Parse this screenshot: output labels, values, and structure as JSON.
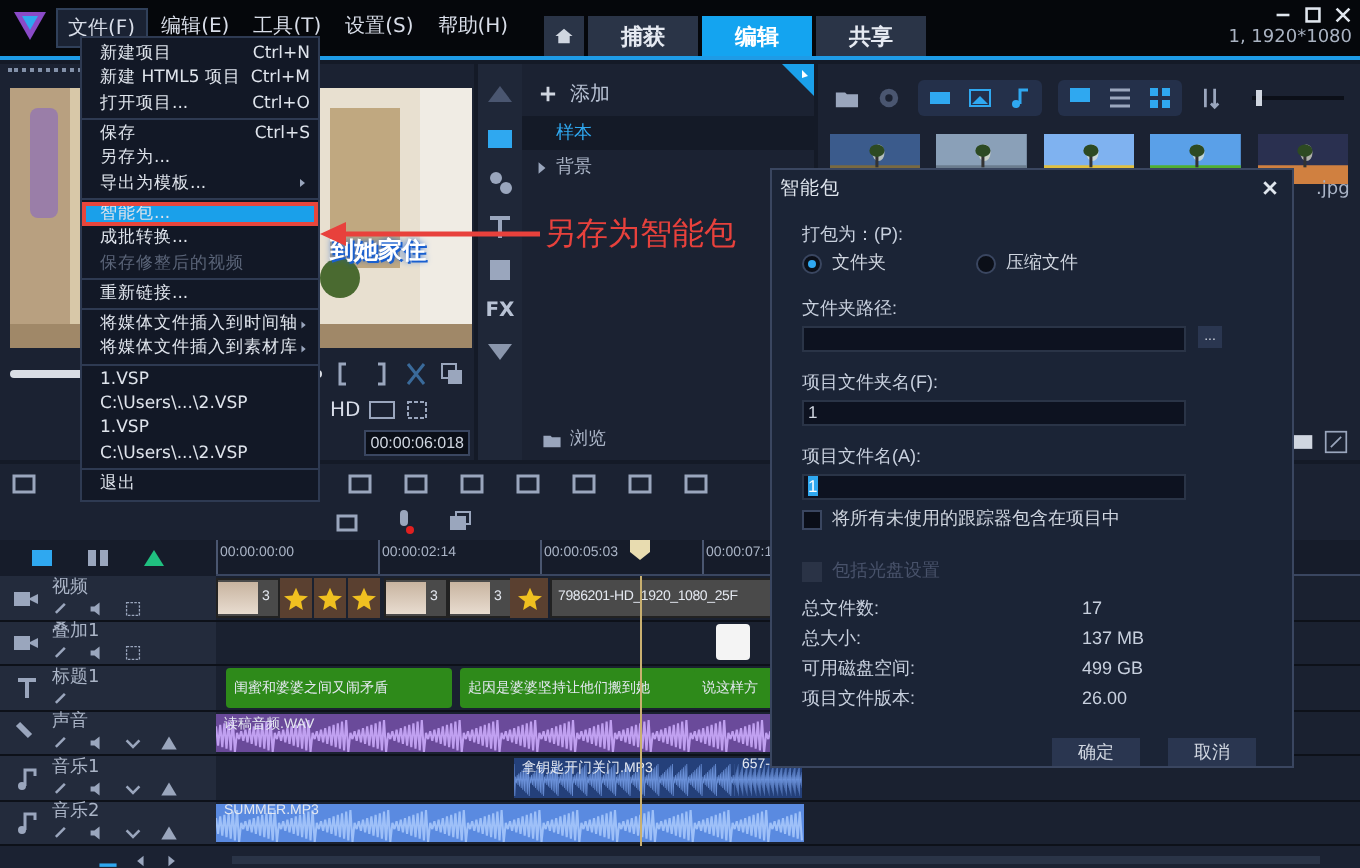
{
  "menubar": {
    "items": [
      {
        "label": "文件(F)",
        "selected": true
      },
      {
        "label": "编辑(E)",
        "selected": false
      },
      {
        "label": "工具(T)",
        "selected": false
      },
      {
        "label": "设置(S)",
        "selected": false
      },
      {
        "label": "帮助(H)",
        "selected": false
      }
    ]
  },
  "tabs": [
    {
      "label": "捕获",
      "selected": false
    },
    {
      "label": "编辑",
      "selected": true
    },
    {
      "label": "共享",
      "selected": false
    }
  ],
  "resolution": "1, 1920*1080",
  "player": {
    "subtitle": "到她家住",
    "format": "HD",
    "timecode": "00:00:06:018"
  },
  "library": {
    "add_label": "添加",
    "nav_fx": "FX",
    "tree": [
      {
        "label": "样本",
        "selected": true,
        "expandable": false
      },
      {
        "label": "背景",
        "selected": false,
        "expandable": true
      }
    ],
    "browse_label": "浏览",
    "zoom_slider": {
      "level": 0.05
    },
    "file_label": ".jpg"
  },
  "timeline": {
    "ruler": [
      "00:00:00:00",
      "00:00:02:14",
      "00:00:05:03",
      "00:00:07:1"
    ],
    "tracks": [
      {
        "kind": "video",
        "name": "视频"
      },
      {
        "kind": "overlay",
        "name": "叠加1"
      },
      {
        "kind": "title",
        "name": "标题1"
      },
      {
        "kind": "voice",
        "name": "声音"
      },
      {
        "kind": "music",
        "name": "音乐1"
      },
      {
        "kind": "music",
        "name": "音乐2"
      }
    ],
    "video_clips": [
      {
        "label": "3"
      },
      {
        "kind": "transition"
      },
      {
        "kind": "transition"
      },
      {
        "kind": "transition"
      },
      {
        "label": "3"
      },
      {
        "label": "3"
      },
      {
        "kind": "transition"
      },
      {
        "kind": "video",
        "label": "7986201-HD_1920_1080_25F"
      }
    ],
    "title_clips": [
      {
        "label": "闺蜜和婆婆之间又闹矛盾"
      },
      {
        "label": "起因是婆婆坚持让他们搬到她"
      },
      {
        "label": "说这样方"
      }
    ],
    "voice_clips": [
      {
        "label": "读稿音频.WAV"
      }
    ],
    "music1_clips": [
      {
        "label": "拿钥匙开门关门.MP3"
      },
      {
        "label": "657-"
      }
    ],
    "music2_clips": [
      {
        "label": "SUMMER.MP3"
      }
    ]
  },
  "file_menu": {
    "groups": [
      {
        "items": [
          {
            "label": "新建项目",
            "shortcut": "Ctrl+N"
          },
          {
            "label": "新建 HTML5 项目",
            "shortcut": "Ctrl+M"
          },
          {
            "label": "打开项目...",
            "shortcut": "Ctrl+O"
          }
        ]
      },
      {
        "items": [
          {
            "label": "保存",
            "shortcut": "Ctrl+S"
          },
          {
            "label": "另存为..."
          },
          {
            "label": "导出为模板...",
            "submenu": true
          }
        ]
      },
      {
        "items": [
          {
            "label": "智能包...",
            "selected": true
          },
          {
            "label": "成批转换..."
          },
          {
            "label": "保存修整后的视频",
            "disabled": true
          }
        ]
      },
      {
        "items": [
          {
            "label": "重新链接..."
          }
        ]
      },
      {
        "items": [
          {
            "label": "将媒体文件插入到时间轴",
            "submenu": true
          },
          {
            "label": "将媒体文件插入到素材库",
            "submenu": true
          }
        ]
      },
      {
        "items": [
          {
            "label": "1.VSP"
          },
          {
            "label": "C:\\Users\\...\\2.VSP"
          },
          {
            "label": "1.VSP"
          },
          {
            "label": "C:\\Users\\...\\2.VSP"
          }
        ]
      },
      {
        "items": [
          {
            "label": "退出"
          }
        ]
      }
    ]
  },
  "annotation": {
    "text": "另存为智能包"
  },
  "dialog": {
    "title": "智能包",
    "pack_label": "打包为：(P):",
    "pack_options": [
      {
        "label": "文件夹",
        "selected": true
      },
      {
        "label": "压缩文件",
        "selected": false
      }
    ],
    "path_label": "文件夹路径:",
    "browse_button": "...",
    "folder_name_label": "项目文件夹名(F):",
    "folder_name": "1",
    "file_name_label": "项目文件名(A):",
    "file_name": "1",
    "checkboxes": [
      {
        "label": "将所有未使用的跟踪器包含在项目中",
        "checked": false,
        "disabled": false
      },
      {
        "label": "包括光盘设置",
        "checked": false,
        "disabled": true
      }
    ],
    "stats": [
      {
        "label": "总文件数:",
        "value": "17"
      },
      {
        "label": "总大小:",
        "value": "137 MB"
      },
      {
        "label": "可用磁盘空间:",
        "value": "499 GB"
      },
      {
        "label": "项目文件版本:",
        "value": "26.00"
      }
    ],
    "buttons": [
      "确定",
      "取消"
    ]
  }
}
